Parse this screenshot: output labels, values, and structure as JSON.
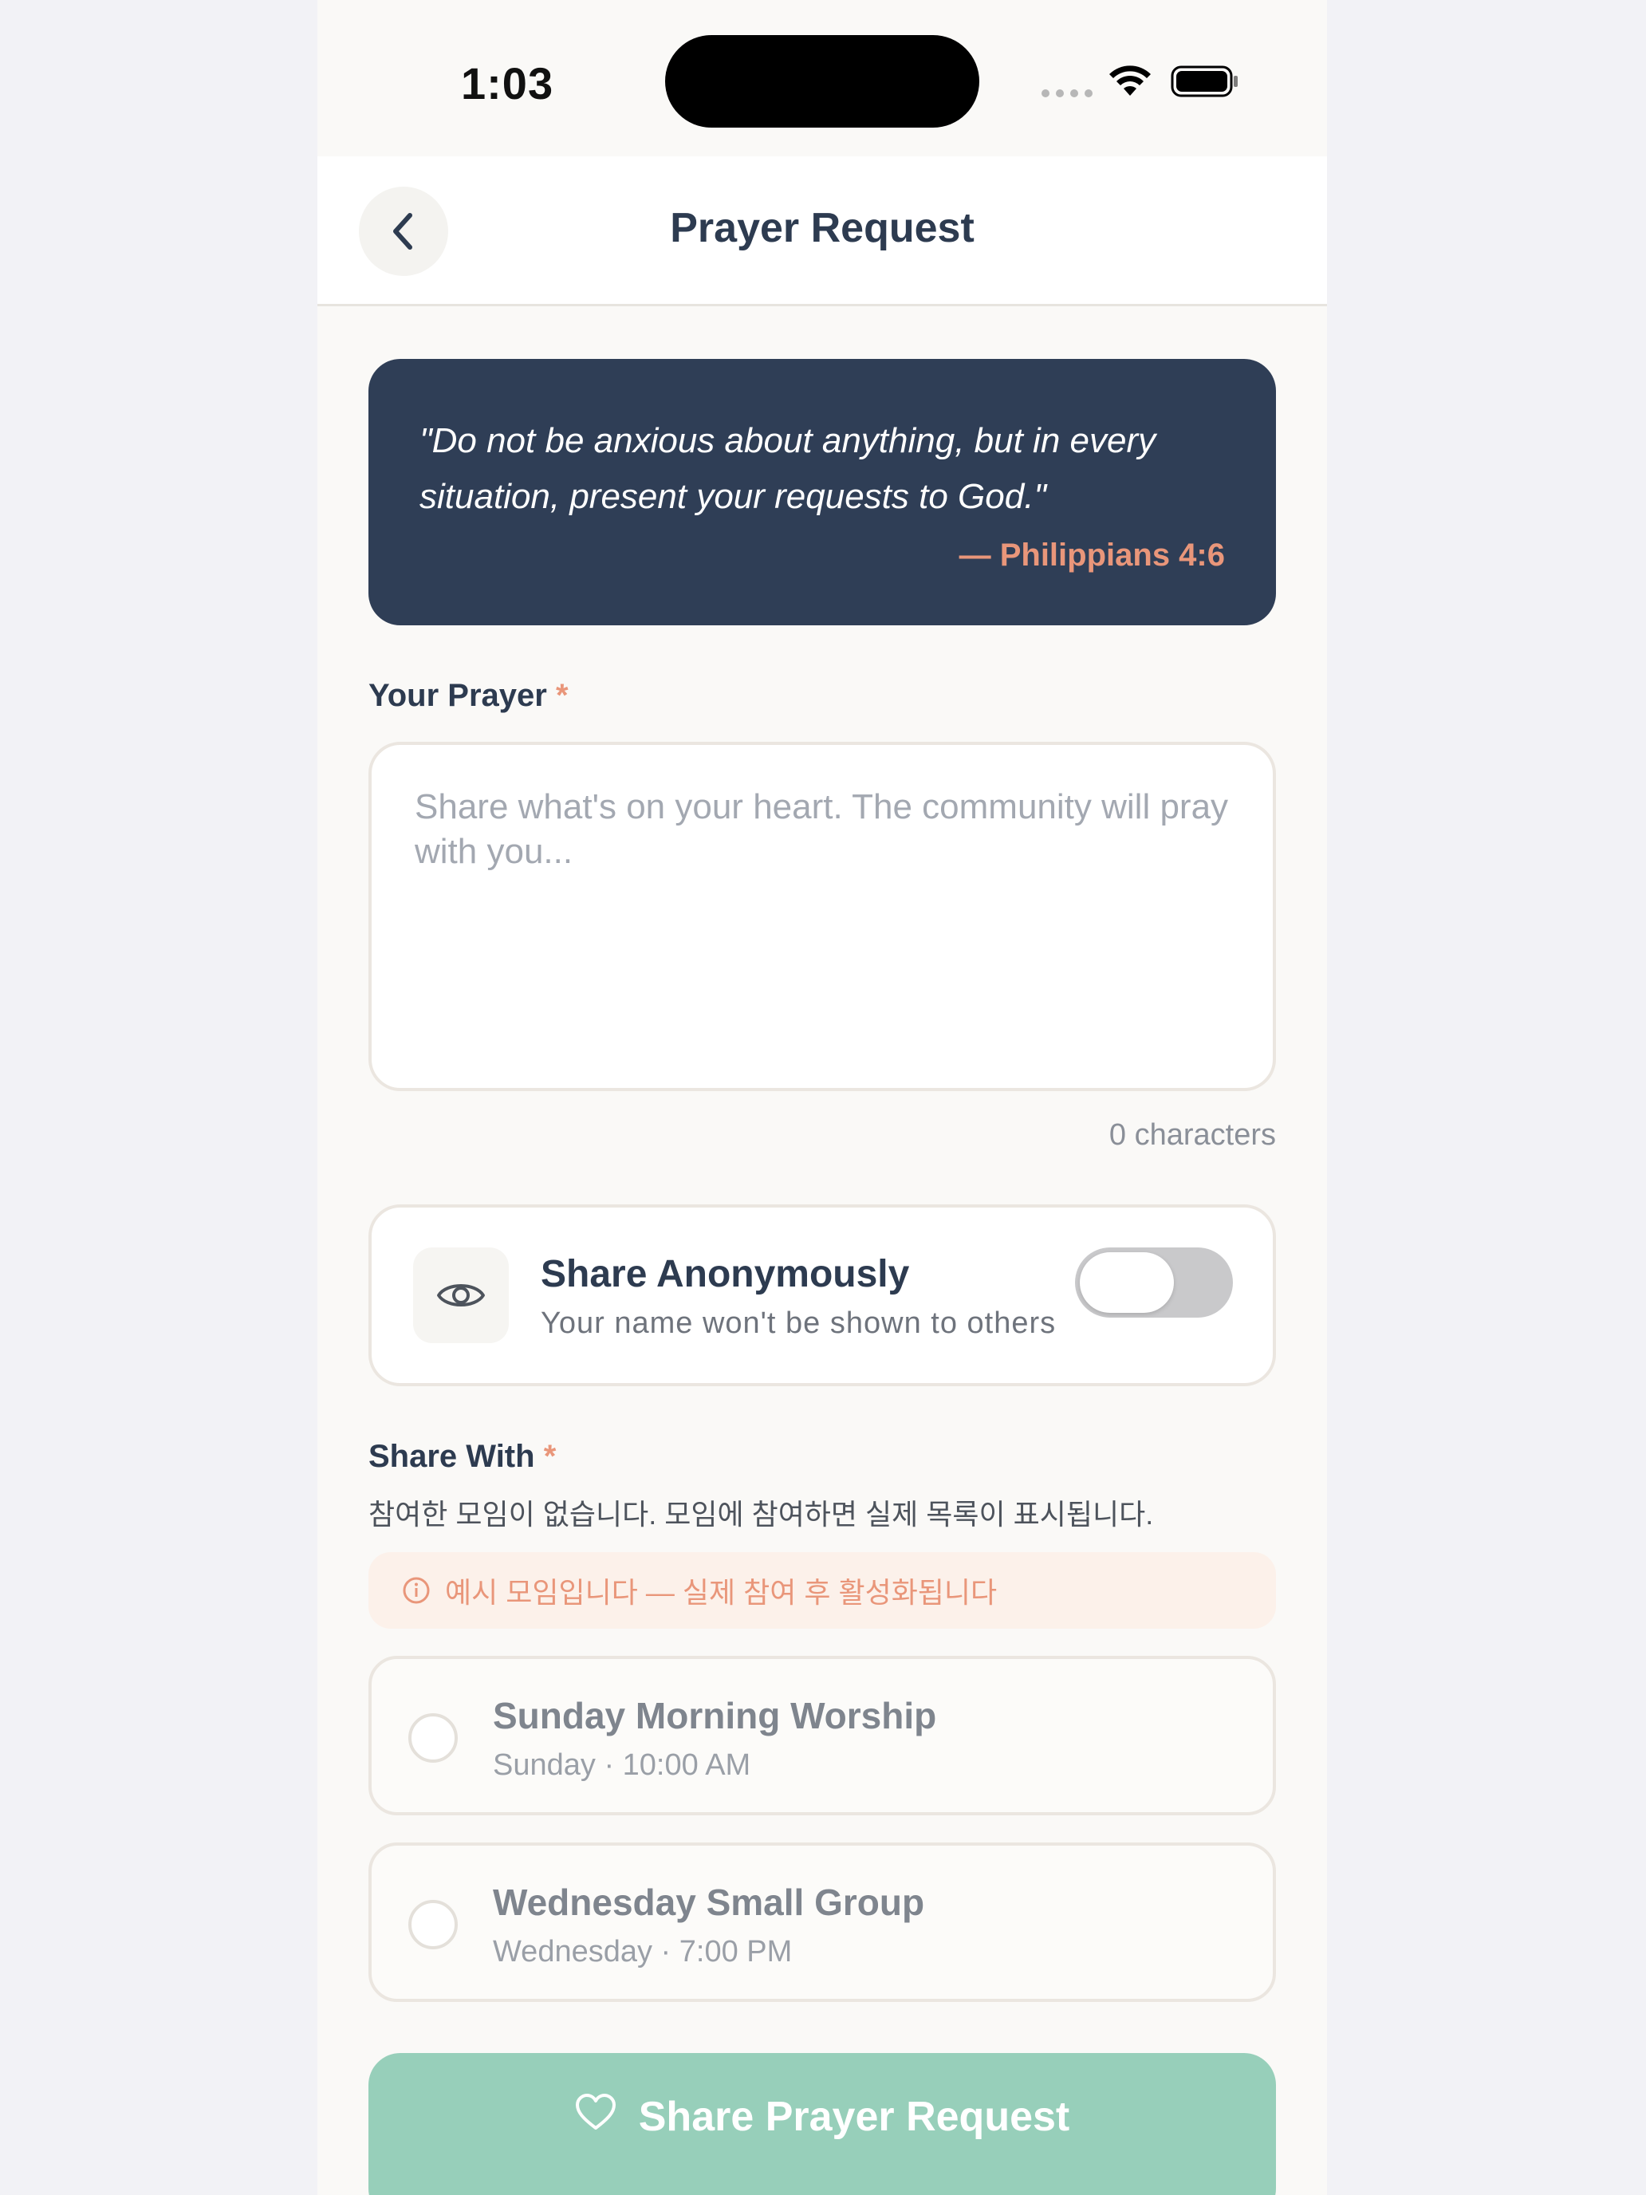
{
  "status_bar": {
    "time": "1:03"
  },
  "nav": {
    "title": "Prayer Request",
    "back_icon": "chevron-left-icon"
  },
  "verse": {
    "text": "\"Do not be anxious about anything, but in every situation, present your requests to God.\"",
    "reference": "— Philippians 4:6"
  },
  "prayer": {
    "label": "Your Prayer",
    "required_mark": "*",
    "value": "",
    "placeholder": "Share what's on your heart. The community will pray with you...",
    "char_count": "0 characters"
  },
  "anonymous": {
    "icon": "eye-icon",
    "title": "Share Anonymously",
    "subtitle": "Your name won't be shown to others",
    "enabled": false
  },
  "share_with": {
    "label": "Share With",
    "required_mark": "*",
    "note": "참여한 모임이 없습니다. 모임에 참여하면 실제 목록이 표시됩니다.",
    "banner": "예시 모임입니다 — 실제 참여 후 활성화됩니다",
    "groups": [
      {
        "name": "Sunday Morning Worship",
        "schedule": "Sunday · 10:00 AM"
      },
      {
        "name": "Wednesday Small Group",
        "schedule": "Wednesday · 7:00 PM"
      }
    ]
  },
  "submit": {
    "label": "Share Prayer Request",
    "icon": "heart-icon"
  },
  "colors": {
    "navy": "#2f3e56",
    "accent": "#e9967a",
    "button": "#97cfba"
  }
}
